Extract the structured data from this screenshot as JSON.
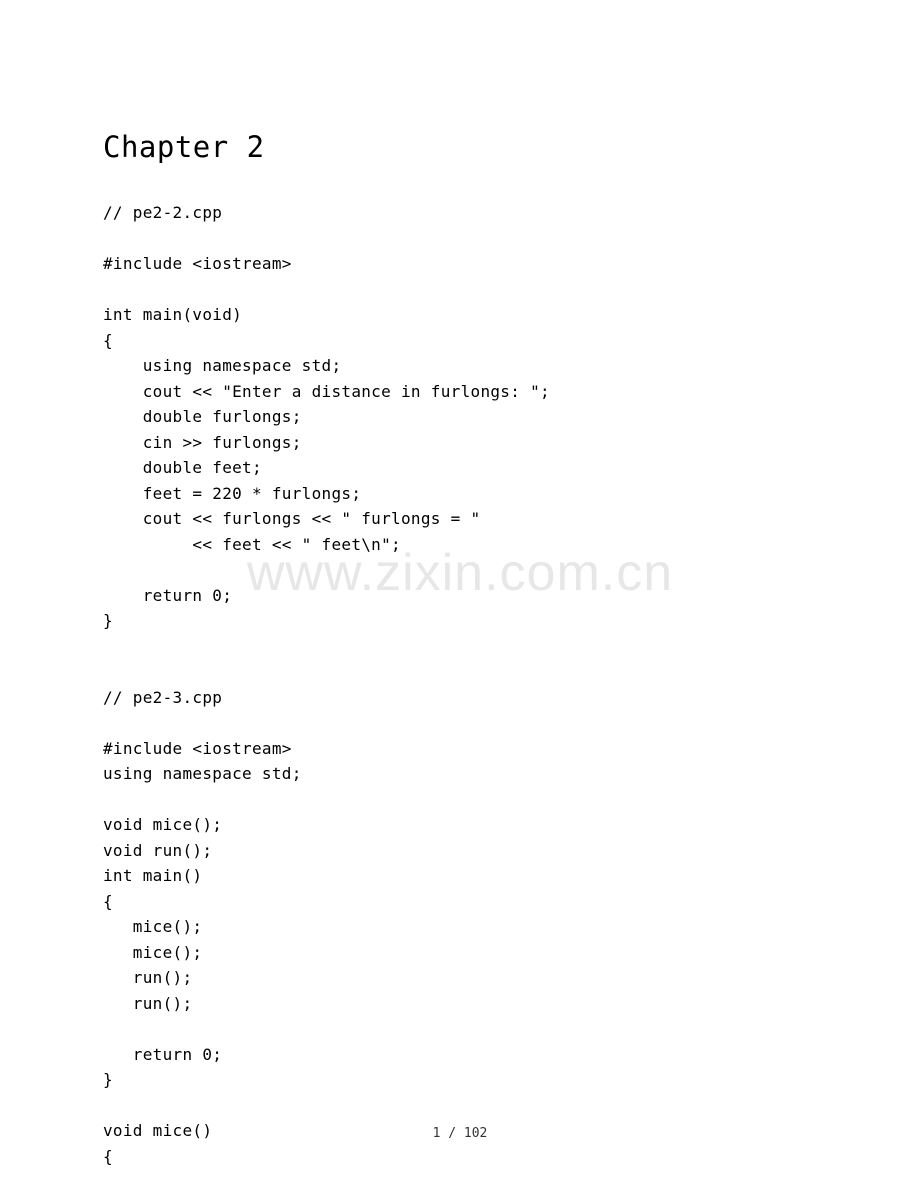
{
  "heading": "Chapter 2",
  "code_lines": [
    "// pe2-2.cpp",
    "",
    "#include <iostream>",
    "",
    "int main(void)",
    "{",
    "    using namespace std;",
    "    cout << \"Enter a distance in furlongs: \";",
    "    double furlongs;",
    "    cin >> furlongs;",
    "    double feet;",
    "    feet = 220 * furlongs;",
    "    cout << furlongs << \" furlongs = \"",
    "         << feet << \" feet\\n\";",
    "",
    "    return 0;  ",
    "}",
    "",
    "",
    "// pe2-3.cpp",
    "",
    "#include <iostream>",
    "using namespace std;",
    "",
    "void mice();",
    "void run();",
    "int main()",
    "{",
    "   mice();",
    "   mice();",
    "   run();",
    "   run();",
    "",
    "   return 0;",
    "}",
    "",
    "void mice()",
    "{"
  ],
  "watermark": "www.zixin.com.cn",
  "footer": "1 / 102"
}
